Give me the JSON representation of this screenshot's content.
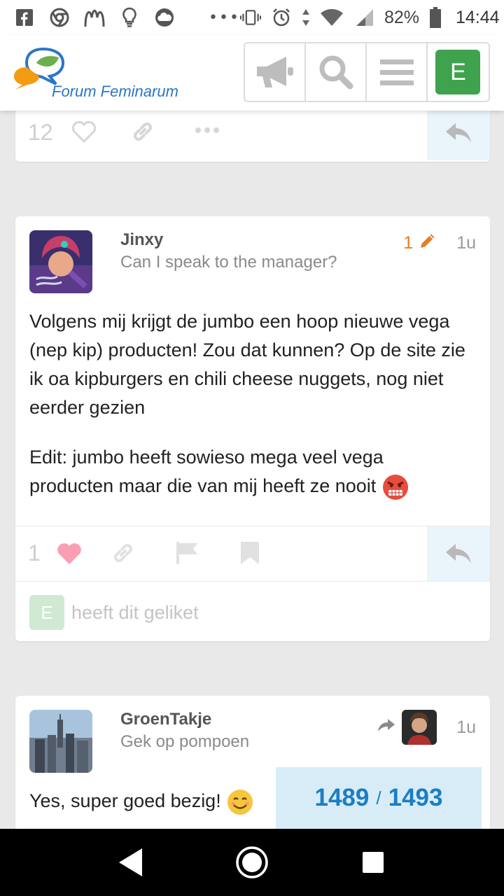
{
  "status_bar": {
    "battery": "82%",
    "time": "14:44",
    "left_icons": [
      "facebook-icon",
      "chrome-icon",
      "mcdonalds-icon",
      "lightbulb-icon",
      "weather-icon"
    ],
    "right_icons": [
      "vibrate-icon",
      "alarm-icon",
      "data-arrows-icon",
      "wifi-icon",
      "signal-icon",
      "battery-icon"
    ]
  },
  "header": {
    "logo_text": "Forum Feminarum",
    "buttons": [
      "announcements-icon",
      "search-icon",
      "menu-icon"
    ],
    "user_avatar_letter": "E",
    "user_avatar_color": "#3fa34d"
  },
  "previous_post": {
    "like_count": "12"
  },
  "post": {
    "username": "Jinxy",
    "user_title": "Can I speak to the manager?",
    "edit_count": "1",
    "time": "1u",
    "paragraph_1": "Volgens mij krijgt de jumbo een hoop nieuwe vega (nep kip) producten! Zou dat kunnen? Op de site zie ik oa kipburgers en chili cheese nuggets, nog niet eerder gezien",
    "paragraph_2": "Edit: jumbo heeft sowieso mega veel vega producten maar die van mij heeft ze nooit",
    "emoji": "angry-face",
    "like_count": "1",
    "liked_by_letter": "E",
    "liked_text": "heeft dit geliket"
  },
  "next_post": {
    "username": "GroenTakje",
    "user_title": "Gek op pompoen",
    "time": "1u",
    "body": "Yes, super goed bezig!",
    "emoji": "smiling-face"
  },
  "progress": {
    "current": "1489",
    "separator": "/",
    "total": "1493"
  },
  "colors": {
    "accent_blue": "#1b7ec4",
    "edit_orange": "#e67e22",
    "like_pink": "#fa6c8d",
    "reply_bg": "#eaf4fb",
    "progress_bg": "#d8ecf8"
  }
}
